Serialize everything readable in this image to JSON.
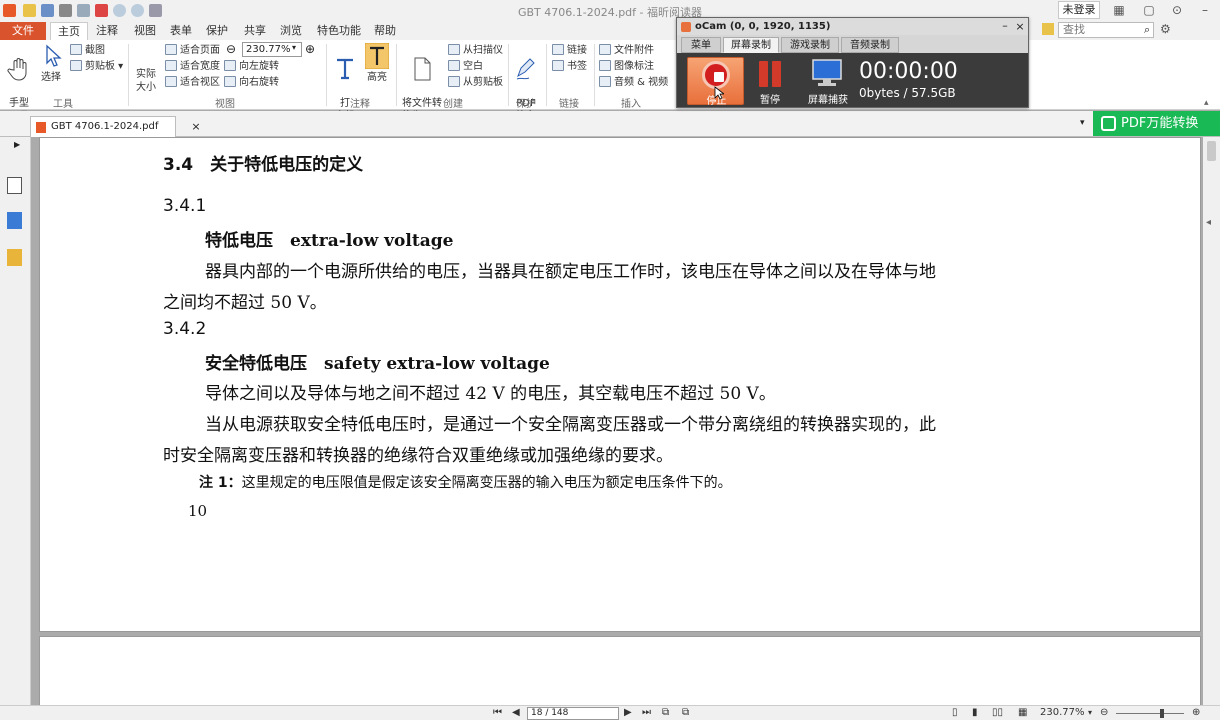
{
  "app": {
    "title": "GBT 4706.1-2024.pdf - 福昕阅读器",
    "login": "未登录",
    "search_placeholder": "查找"
  },
  "menu": {
    "tabs": [
      "文件",
      "主页",
      "注释",
      "视图",
      "表单",
      "保护",
      "共享",
      "浏览",
      "特色功能",
      "帮助"
    ],
    "active": "主页"
  },
  "ribbon": {
    "hand_tool": "手型\n工具",
    "select": "选择",
    "screenshot": "截图",
    "clipboard": "剪贴板",
    "actual_size": "实际\n大小",
    "fit_page": "适合页面",
    "fit_width": "适合宽度",
    "fit_view": "适合视区",
    "zoom_value": "230.77%",
    "rotate_left": "向左旋转",
    "rotate_right": "向右旋转",
    "typewriter": "打\n字机",
    "highlight": "高亮",
    "file_to_pdf": "将文件转\n换为PDF",
    "from_scanner": "从扫描仪",
    "blank": "空白",
    "from_clipboard": "从剪贴板",
    "pdf_sign": "PDF\n签名",
    "link": "链接",
    "bookmark": "书签",
    "file_attachment": "文件附件",
    "image_annotation": "图像标注",
    "audio_video": "音频 & 视频",
    "groups": {
      "tools": "工具",
      "view": "视图",
      "comment": "注释",
      "create": "创建",
      "protect": "保护",
      "links": "链接",
      "insert": "插入"
    }
  },
  "doc_tab": {
    "filename": "GBT 4706.1-2024.pdf",
    "close": "×"
  },
  "pdf_convert_button": "PDF万能转换",
  "document": {
    "section_title": "3.4　关于特低电压的定义",
    "s341_number": "3.4.1",
    "s341_term": "特低电压　extra-low voltage",
    "s341_def_line1": "器具内部的一个电源所供给的电压，当器具在额定电压工作时，该电压在导体之间以及在导体与地",
    "s341_def_line2": "之间均不超过 50 V。",
    "s342_number": "3.4.2",
    "s342_term": "安全特低电压　safety extra-low voltage",
    "s342_def_line1": "导体之间以及导体与地之间不超过 42 V 的电压，其空载电压不超过 50 V。",
    "s342_def_line2": "当从电源获取安全特低电压时，是通过一个安全隔离变压器或一个带分离绕组的转换器实现的，此",
    "s342_def_line3": "时安全隔离变压器和转换器的绝缘符合双重绝缘或加强绝缘的要求。",
    "note_label": "注 1：",
    "note_text": "这里规定的电压限值是假定该安全隔离变压器的输入电压为额定电压条件下的。",
    "page_number": "10"
  },
  "statusbar": {
    "page_display": "18 / 148",
    "zoom": "230.77%"
  },
  "ocam": {
    "title": "oCam (0, 0, 1920, 1135)",
    "tabs": [
      "菜单",
      "屏幕录制",
      "游戏录制",
      "音频录制"
    ],
    "active_tab": "屏幕录制",
    "stop": "停止",
    "pause": "暂停",
    "capture": "屏幕捕获",
    "timer": "00:00:00",
    "bytes": "0bytes / 57.5GB"
  },
  "colors": {
    "file_tab": "#d9532c",
    "convert_green": "#19b955",
    "ocam_stop": "#e8703c"
  }
}
